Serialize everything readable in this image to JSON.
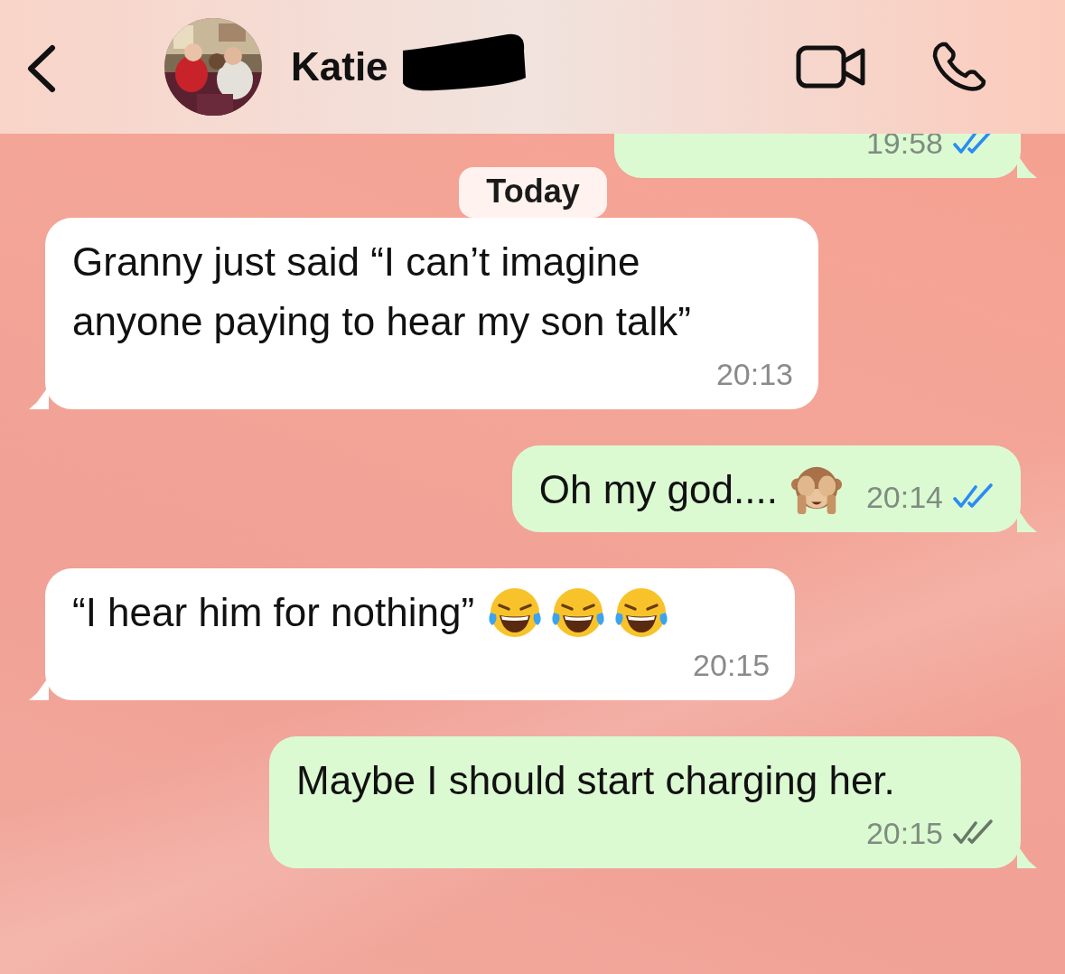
{
  "header": {
    "contact_name": "Katie"
  },
  "items": [
    {
      "kind": "outgoing",
      "time": "19:58",
      "read": true
    },
    {
      "kind": "date",
      "text": "Today"
    },
    {
      "kind": "incoming",
      "text": "Granny just said “I can’t imagine anyone paying to hear my son talk”",
      "time": "20:13"
    },
    {
      "kind": "outgoing",
      "text": "Oh my god....",
      "emojis": [
        {
          "kind": "monkey"
        }
      ],
      "time": "20:14",
      "read": true
    },
    {
      "kind": "incoming",
      "text": "“I hear him for nothing”",
      "emojis": [
        {
          "kind": "laughing"
        },
        {
          "kind": "laughing"
        },
        {
          "kind": "laughing"
        }
      ],
      "time": "20:15"
    },
    {
      "kind": "outgoing",
      "text": "Maybe I should start charging her.",
      "time": "20:15",
      "read": false
    }
  ]
}
